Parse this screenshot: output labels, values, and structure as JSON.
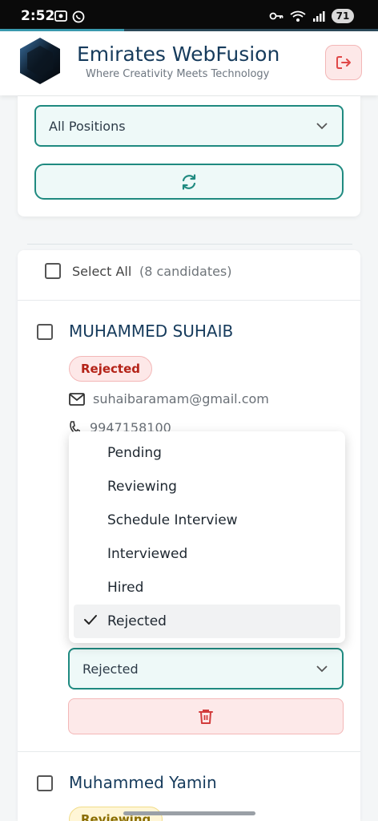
{
  "status_bar": {
    "time": "2:52",
    "battery": "71"
  },
  "header": {
    "brand": "Emirates WebFusion",
    "tagline": "Where Creativity Meets Technology"
  },
  "filters": {
    "position_select": "All Positions"
  },
  "list": {
    "select_all_label": "Select All",
    "candidate_count": "(8 candidates)"
  },
  "candidates": [
    {
      "name": "MUHAMMED SUHAIB",
      "status": "Rejected",
      "email": "suhaibaramam@gmail.com",
      "phone": "9947158100",
      "status_select_value": "Rejected"
    },
    {
      "name": "Muhammed Yamin",
      "status": "Reviewing"
    }
  ],
  "status_menu": {
    "options": [
      "Pending",
      "Reviewing",
      "Schedule Interview",
      "Interviewed",
      "Hired",
      "Rejected"
    ],
    "selected": "Rejected"
  },
  "colors": {
    "accent": "#1f8a80",
    "brand_text": "#163b5c",
    "danger": "#b42318",
    "danger_bg": "#fde8e8"
  },
  "icons": {
    "logo": "hexagon-logo",
    "logout": "logout-icon",
    "refresh": "refresh-icon",
    "email": "mail-icon",
    "phone": "phone-icon",
    "delete": "trash-icon",
    "dropdown": "chevron-down-icon",
    "selected": "checkmark-icon"
  }
}
